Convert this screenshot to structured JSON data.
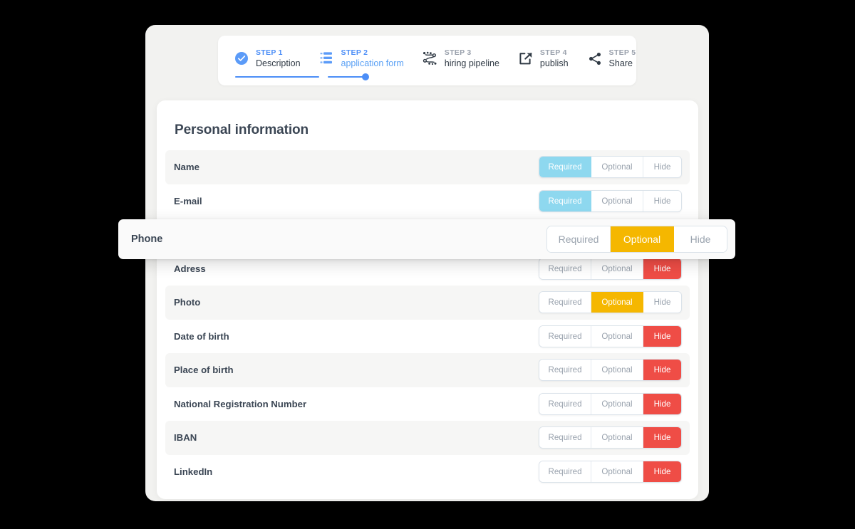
{
  "stepper": {
    "steps": [
      {
        "kicker": "STEP 1",
        "label": "Description",
        "icon": "check-circle-icon",
        "state": "done"
      },
      {
        "kicker": "STEP 2",
        "label": "application form",
        "icon": "list-icon",
        "state": "active"
      },
      {
        "kicker": "STEP 3",
        "label": "hiring pipeline",
        "icon": "pipeline-icon",
        "state": "todo"
      },
      {
        "kicker": "STEP 4",
        "label": "publish",
        "icon": "publish-icon",
        "state": "todo"
      },
      {
        "kicker": "STEP 5",
        "label": "Share",
        "icon": "share-nodes-icon",
        "state": "todo"
      }
    ],
    "progress": {
      "value": 33,
      "segments": 2
    }
  },
  "panel": {
    "title": "Personal information",
    "options": {
      "required": "Required",
      "optional": "Optional",
      "hide": "Hide"
    },
    "fields": [
      {
        "label": "Name",
        "selected": "required-soft",
        "shaded": true
      },
      {
        "label": "E-mail",
        "selected": "required-soft",
        "shaded": false
      },
      {
        "label": "Phone",
        "selected": "optional",
        "shaded": true
      },
      {
        "label": "Adress",
        "selected": "hide",
        "shaded": false
      },
      {
        "label": "Photo",
        "selected": "optional",
        "shaded": true
      },
      {
        "label": "Date of birth",
        "selected": "hide",
        "shaded": false
      },
      {
        "label": "Place of birth",
        "selected": "hide",
        "shaded": true
      },
      {
        "label": "National Registration Number",
        "selected": "hide",
        "shaded": false
      },
      {
        "label": "IBAN",
        "selected": "hide",
        "shaded": true
      },
      {
        "label": "LinkedIn",
        "selected": "hide",
        "shaded": false
      }
    ]
  },
  "floating_row": {
    "label": "Phone",
    "options": {
      "required": "Required",
      "optional": "Optional",
      "hide": "Hide"
    },
    "selected": "optional"
  },
  "colors": {
    "accent_blue": "#4c8ef7",
    "soft_blue": "#8ed8ef",
    "amber": "#f5b700",
    "red": "#ef4d46",
    "text_dark": "#3b4654",
    "text_muted": "#9aa3ae",
    "page_bg": "#000000",
    "shell_bg": "#f2f2f0"
  }
}
